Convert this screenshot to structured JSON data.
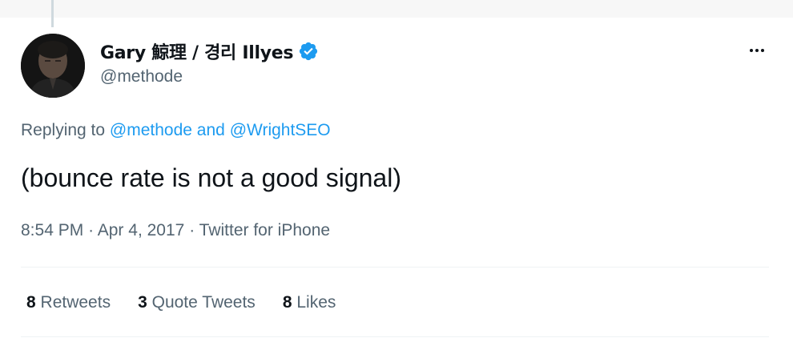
{
  "tweet": {
    "author": {
      "display_name": "Gary 鯨理 / 경리 Illyes",
      "handle": "@methode",
      "verified": true,
      "verified_color": "#1d9bf0"
    },
    "reply": {
      "prefix": "Replying to",
      "mention_1": "@methode",
      "conjunction": "and",
      "mention_2": "@WrightSEO"
    },
    "text": "(bounce rate is not a good signal)",
    "meta": {
      "time": "8:54 PM",
      "separator": "·",
      "date": "Apr 4, 2017",
      "source": "Twitter for iPhone"
    },
    "stats": [
      {
        "count": "8",
        "label": "Retweets"
      },
      {
        "count": "3",
        "label": "Quote Tweets"
      },
      {
        "count": "8",
        "label": "Likes"
      }
    ],
    "icons": {
      "more": "more-horizontal-icon",
      "verified": "verified-badge-icon"
    },
    "colors": {
      "link": "#1d9bf0",
      "secondary_text": "#536471",
      "primary_text": "#0f1419"
    }
  }
}
